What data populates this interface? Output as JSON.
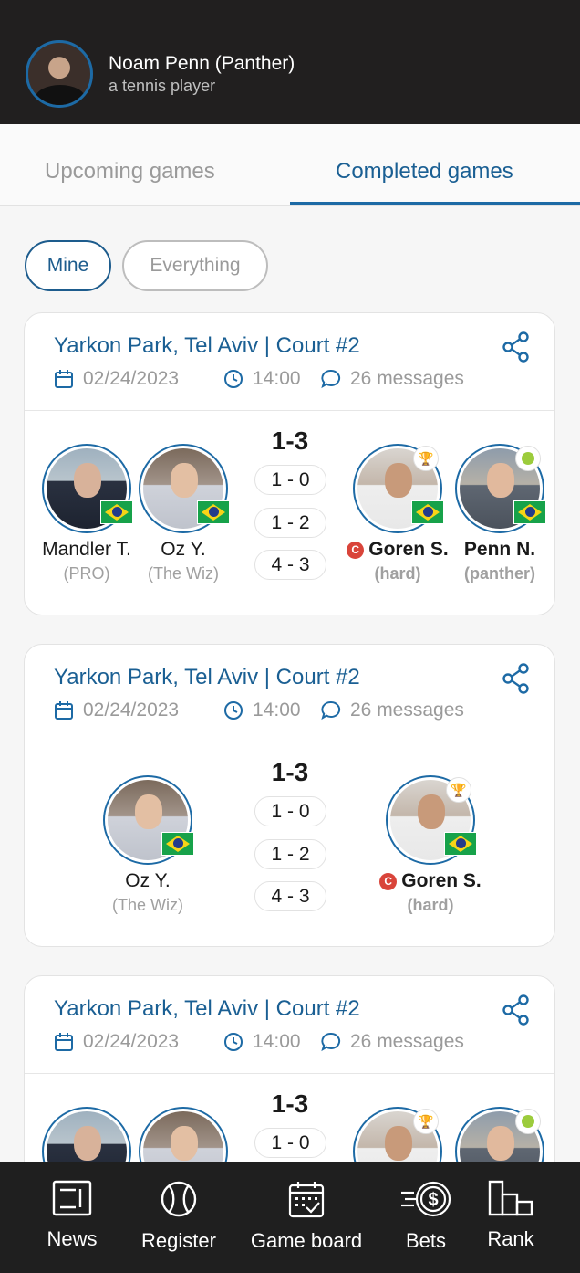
{
  "header": {
    "name": "Noam Penn (Panther)",
    "subtitle": "a tennis player"
  },
  "tabs": [
    {
      "label": "Upcoming games"
    },
    {
      "label": "Completed games"
    }
  ],
  "filters": {
    "mine": "Mine",
    "everything": "Everything"
  },
  "games": [
    {
      "venue": "Yarkon Park, Tel Aviv | Court #2",
      "date": "02/24/2023",
      "time": "14:00",
      "messages": "26 messages",
      "score": "1-3",
      "sets": [
        "1 - 0",
        "1 - 2",
        "4 - 3"
      ],
      "team1": [
        {
          "name": "Mandler T.",
          "nick": "(PRO)"
        },
        {
          "name": "Oz Y.",
          "nick": "(The Wiz)"
        }
      ],
      "team2": [
        {
          "name": "Goren S.",
          "nick": "(hard)"
        },
        {
          "name": "Penn N.",
          "nick": "(panther)"
        }
      ]
    },
    {
      "venue": "Yarkon Park, Tel Aviv | Court #2",
      "date": "02/24/2023",
      "time": "14:00",
      "messages": "26 messages",
      "score": "1-3",
      "sets": [
        "1 - 0",
        "1 - 2",
        "4 - 3"
      ],
      "team1": [
        {
          "name": "Oz Y.",
          "nick": "(The Wiz)"
        }
      ],
      "team2": [
        {
          "name": "Goren S.",
          "nick": "(hard)"
        }
      ]
    },
    {
      "venue": "Yarkon Park, Tel Aviv | Court #2",
      "date": "02/24/2023",
      "time": "14:00",
      "messages": "26 messages",
      "score": "1-3",
      "sets": [
        "1 - 0"
      ]
    }
  ],
  "nav": [
    {
      "label": "News"
    },
    {
      "label": "Register"
    },
    {
      "label": "Game board"
    },
    {
      "label": "Bets"
    },
    {
      "label": "Rank"
    }
  ],
  "colors": {
    "accent": "#1d6aa5",
    "topbar": "#211f1f",
    "bottombar": "#1f1f1f"
  }
}
